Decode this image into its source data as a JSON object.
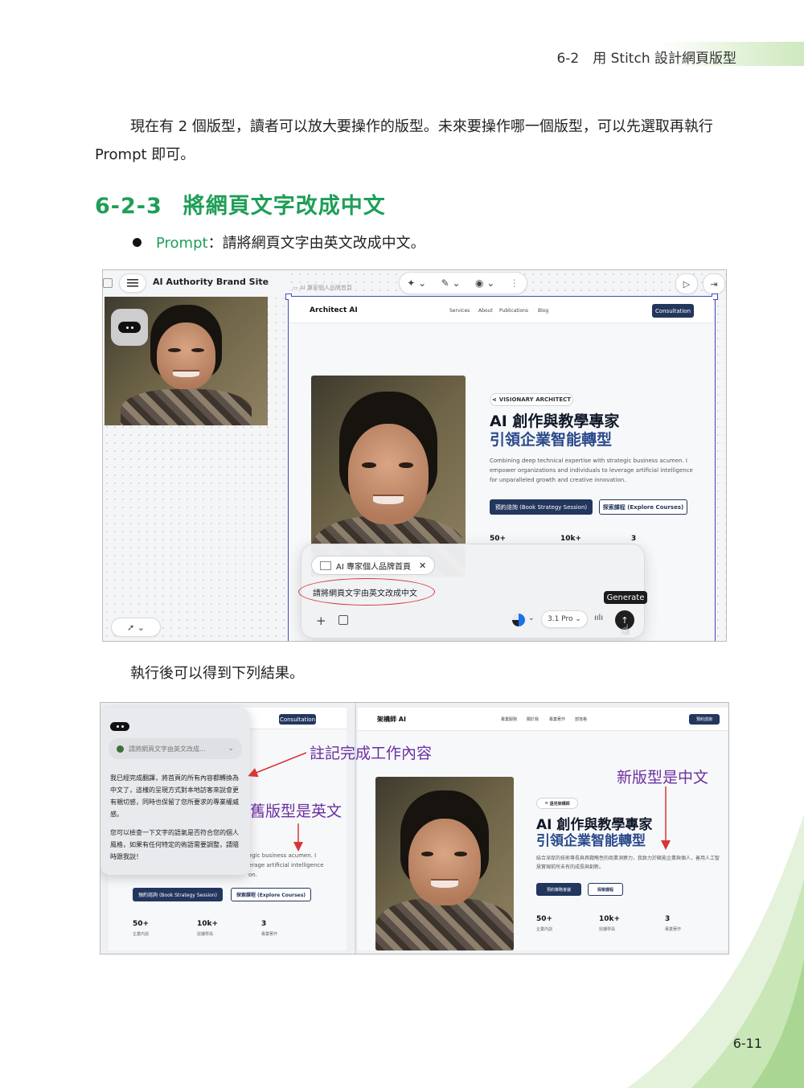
{
  "running_head": "6-2　用 Stitch 設計網頁版型",
  "page_number": "6-11",
  "intro_paragraph": "現在有 2 個版型，讀者可以放大要操作的版型。未來要操作哪一個版型，可以先選取再執行 Prompt 即可。",
  "section": {
    "number": "6-2-3",
    "title": "將網頁文字改成中文"
  },
  "bullet": {
    "keyword": "Prompt",
    "text": "：請將網頁文字由英文改成中文。"
  },
  "after_paragraph": "執行後可以得到下列結果。",
  "colors": {
    "section_green": "#1e9e57",
    "navy": "#23365e",
    "hero_blue": "#2b4a8b",
    "annotation_purple": "#6b2fa0",
    "annotation_red": "#d83535"
  },
  "screenshot1": {
    "app_title": "AI Authority Brand Site",
    "canvas_label": "AI 專家個人品牌首頁",
    "site": {
      "brand": "Architect AI",
      "nav": [
        "Services",
        "About",
        "Publications",
        "Blog"
      ],
      "nav_button": "Consultation",
      "badge": "VISIONARY ARCHITECT",
      "title_line1": "AI 創作與教學專家",
      "title_line2": "引領企業智能轉型",
      "description": "Combining deep technical expertise with strategic business acumen. I empower organizations and individuals to leverage artificial intelligence for unparalleled growth and creative innovation.",
      "cta_primary": "預約諮詢 (Book Strategy Session)",
      "cta_secondary": "探索課程 (Explore Courses)",
      "stats": [
        {
          "value": "50+"
        },
        {
          "value": "10k+"
        },
        {
          "value": "3"
        }
      ]
    },
    "prompt_chip": "AI 專家個人品牌首頁",
    "prompt_text": "請將網頁文字由英文改成中文",
    "model": "3.1 Pro",
    "tooltip": "Generate",
    "icons": [
      "menu-icon",
      "chat-bubble-icon",
      "sparkle-icon",
      "pen-icon",
      "eye-icon",
      "more-icon",
      "play-icon",
      "export-icon",
      "rocket-icon",
      "plus-icon",
      "image-icon",
      "mic-icon",
      "send-arrow-icon",
      "close-icon"
    ]
  },
  "screenshot2": {
    "left_nav_button": "Consultation",
    "chat_header": "請將網頁文字由英文改成...",
    "chat_para1": "我已經完成翻譯，將首頁的所有內容都轉換為中文了，這樣的呈現方式對本地訪客來說會更有親切感，同時也保留了您所要求的專業權威感。",
    "chat_para2": "您可以檢查一下文字的語氣是否符合您的個人風格，如果有任何特定的術語需要調整，請隨時跟我說！",
    "old_partial_line1": "egic business acumen. I",
    "old_partial_line2": "erage artificial intelligence",
    "old_partial_line3": "on.",
    "old_cta_primary": "預約諮詢 (Book Strategy Session)",
    "old_cta_secondary": "探索課程 (Explore Courses)",
    "old_stats": [
      {
        "value": "50+",
        "label": "企業內訓"
      },
      {
        "value": "10k+",
        "label": "授課學員"
      },
      {
        "value": "3",
        "label": "專業著作"
      }
    ],
    "new_site": {
      "brand": "架構師 AI",
      "nav": [
        "專業服務",
        "關於我",
        "專業著作",
        "部落格"
      ],
      "nav_button": "預約諮詢",
      "badge": "遠見架構師",
      "title_line1": "AI 創作與教學專家",
      "title_line2": "引領企業智能轉型",
      "description": "結合深厚的技術專長與具戰略性的商業洞察力，我致力於賦能企業與個人，善用人工智慧實現前所未有的成長與創新。",
      "cta_primary": "預約策略會議",
      "cta_secondary": "探索課程",
      "stats": [
        {
          "value": "50+",
          "label": "企業內訓"
        },
        {
          "value": "10k+",
          "label": "授課學員"
        },
        {
          "value": "3",
          "label": "專業著作"
        }
      ]
    },
    "annotations": {
      "note": "註記完成工作內容",
      "new_layout": "新版型是中文",
      "old_layout": "舊版型是英文"
    }
  }
}
